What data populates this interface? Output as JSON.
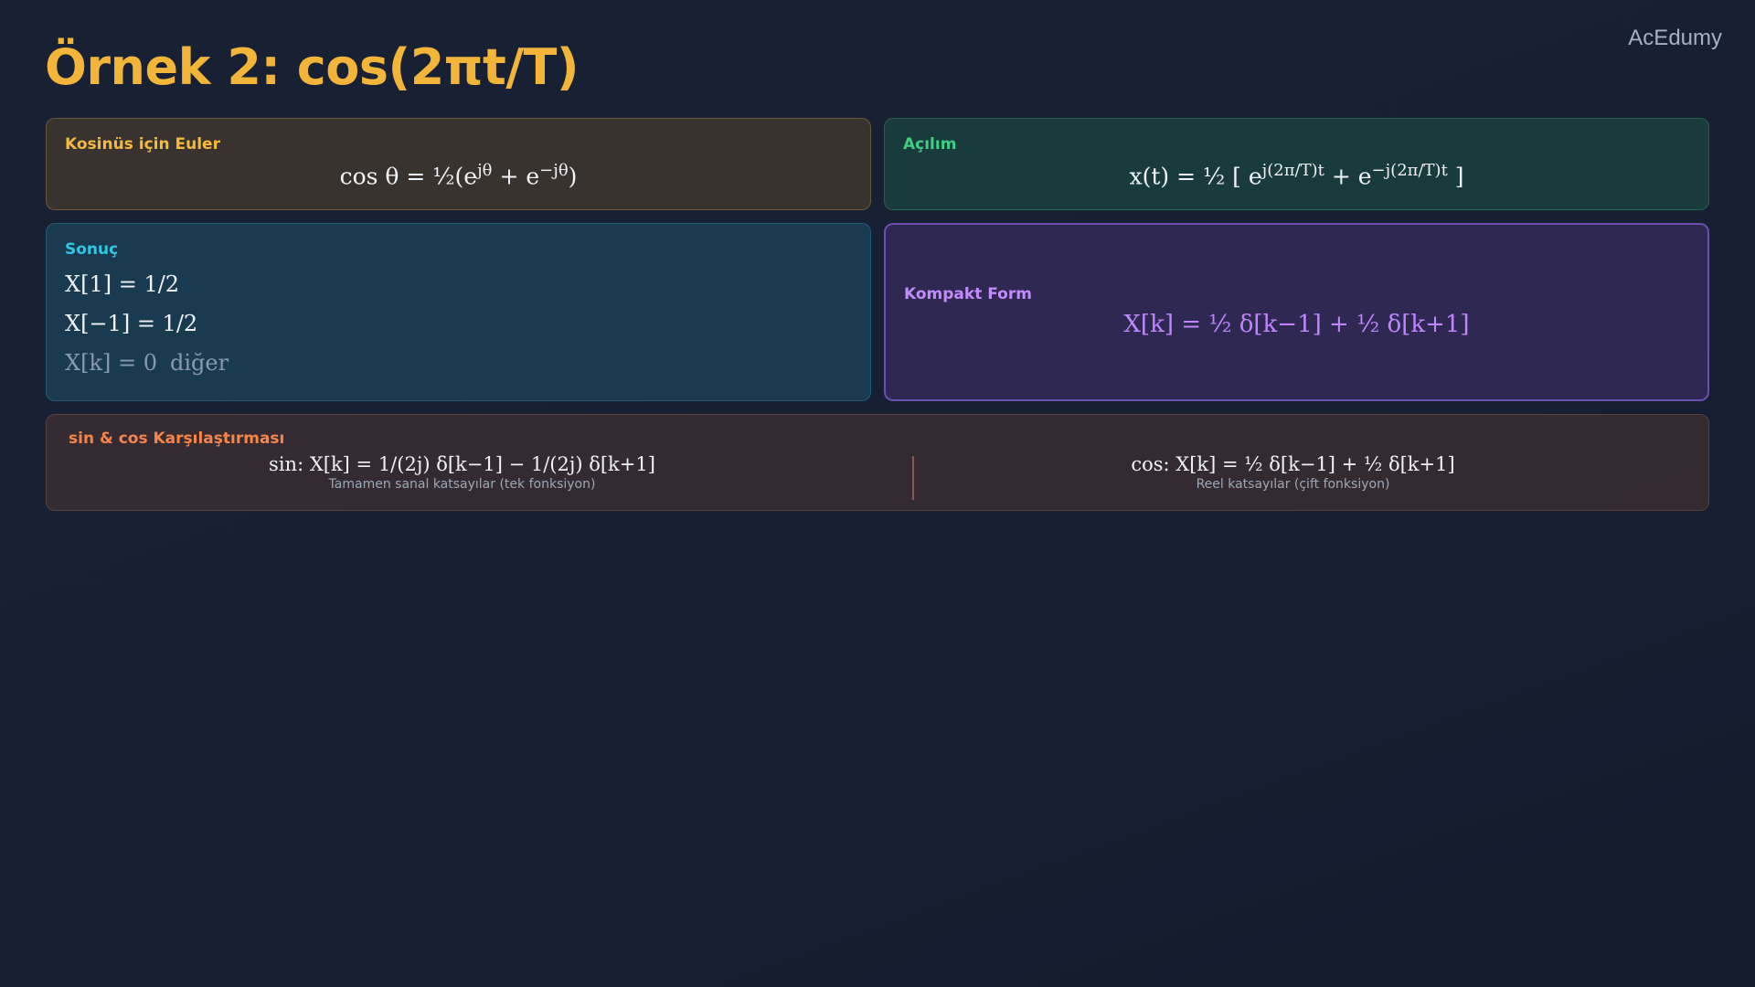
{
  "brand": "AcEdumy",
  "title": "Örnek 2: cos(2πt/T)",
  "euler": {
    "label": "Kosinüs için Euler",
    "formula_a": "cos θ = ½(e",
    "formula_sup1": "jθ",
    "formula_b": " + e",
    "formula_sup2": "−jθ",
    "formula_c": ")"
  },
  "expansion": {
    "label": "Açılım",
    "formula_a": "x(t) = ½ [ e",
    "formula_sup1": "j(2π/T)t",
    "formula_b": " + e",
    "formula_sup2": "−j(2π/T)t",
    "formula_c": " ]"
  },
  "result": {
    "label": "Sonuç",
    "lines": [
      "X[1] = 1/2",
      "X[−1] = 1/2"
    ],
    "other_formula": "X[k] = 0",
    "other_word": "diğer"
  },
  "compact": {
    "label": "Kompakt Form",
    "formula": "X[k] = ½ δ[k−1] + ½ δ[k+1]"
  },
  "comparison": {
    "label": "sin & cos Karşılaştırması",
    "sin": {
      "formula": "sin: X[k] = 1/(2j) δ[k−1] − 1/(2j) δ[k+1]",
      "note": "Tamamen sanal katsayılar (tek fonksiyon)"
    },
    "cos": {
      "formula": "cos: X[k] = ½ δ[k−1] + ½ δ[k+1]",
      "note": "Reel katsayılar (çift fonksiyon)"
    }
  },
  "colors": {
    "title": "#f2b53a",
    "euler_accent": "#f5b93c",
    "expansion_accent": "#3ecf82",
    "result_accent": "#2ec7e6",
    "compact_accent": "#c48bff",
    "comparison_accent": "#f7854a"
  }
}
